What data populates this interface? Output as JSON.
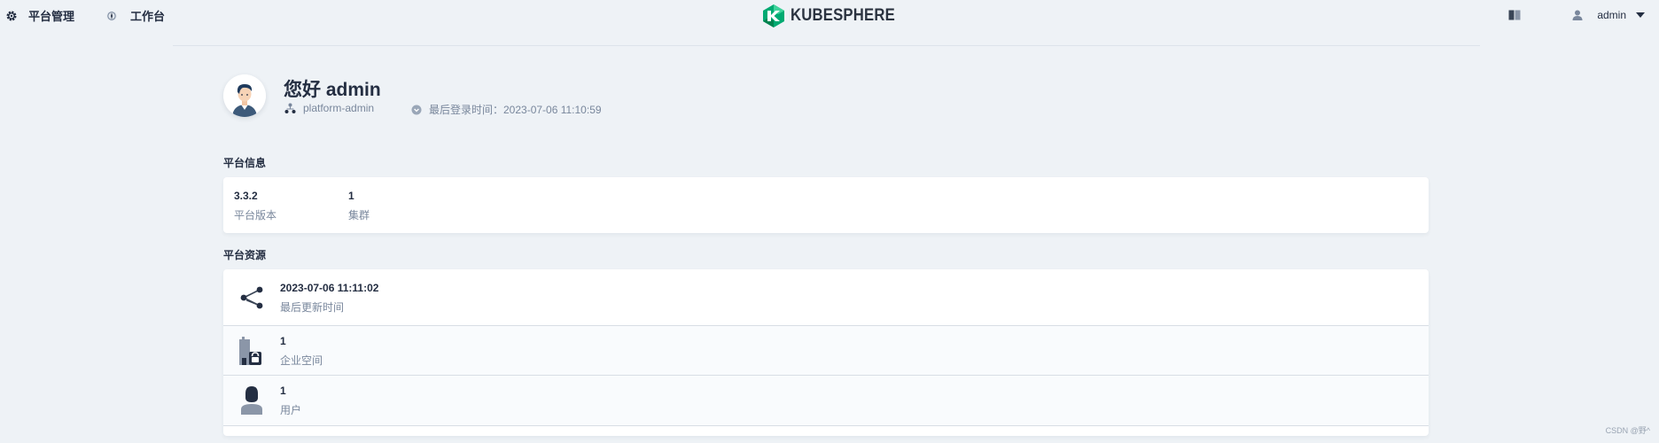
{
  "topbar": {
    "platform_label": "平台管理",
    "workbench_label": "工作台",
    "logo_text": "KUBESPHERE",
    "username": "admin"
  },
  "greeting": {
    "title": "您好 admin",
    "role": "platform-admin",
    "last_login": "最后登录时间：2023-07-06 11:10:59"
  },
  "platform_info": {
    "title": "平台信息",
    "items": [
      {
        "value": "3.3.2",
        "label": "平台版本"
      },
      {
        "value": "1",
        "label": "集群"
      }
    ]
  },
  "platform_resources": {
    "title": "平台资源",
    "items": [
      {
        "value": "2023-07-06 11:11:02",
        "label": "最后更新时间",
        "icon": "share-nodes-icon"
      },
      {
        "value": "1",
        "label": "企业空间",
        "icon": "workspace-icon"
      },
      {
        "value": "1",
        "label": "用户",
        "icon": "user-icon"
      }
    ]
  },
  "watermark": "CSDN @野^",
  "colors": {
    "background": "#eef2f6",
    "brand_green": "#00aa72",
    "text_primary": "#242e42",
    "text_secondary": "#79879c"
  }
}
